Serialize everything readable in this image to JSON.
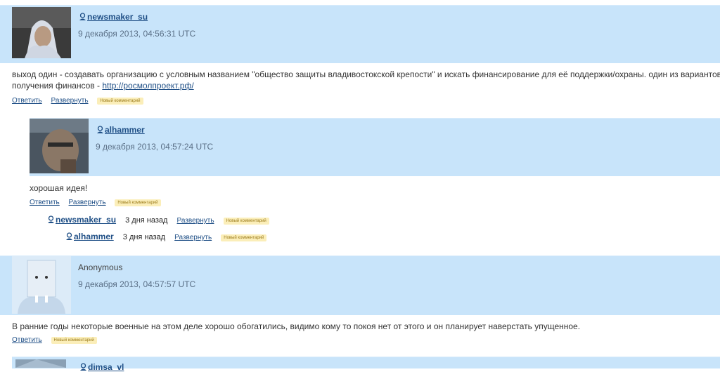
{
  "comments": [
    {
      "user": "newsmaker_su",
      "date": "9 декабря 2013, 04:56:31 UTC",
      "text_line1": "выход один - создавать организацию с условным названием \"общество защиты владивостокской крепости\" и искать финансирование для её поддержки/охраны. один из вариантов",
      "text_line2_prefix": "получения финансов - ",
      "link": "http://росмолпроект.рф/",
      "reply": "Ответить",
      "expand": "Развернуть",
      "badge": "Новый комментарий"
    },
    {
      "user": "alhammer",
      "date": "9 декабря 2013, 04:57:24 UTC",
      "text": "хорошая идея!",
      "reply": "Ответить",
      "expand": "Развернуть",
      "badge": "Новый комментарий"
    },
    {
      "user": "Anonymous",
      "date": "9 декабря 2013, 04:57:57 UTC",
      "text": "В ранние годы некоторые военные на этом деле хорошо обогатились, видимо кому то покоя нет от этого и он планирует наверстать упущенное.",
      "reply": "Ответить",
      "badge": "Новый комментарий"
    },
    {
      "user": "dimsa_vl"
    }
  ],
  "collapsed": [
    {
      "user": "newsmaker_su",
      "time": "3 дня назад",
      "expand": "Развернуть",
      "badge": "Новый комментарий"
    },
    {
      "user": "alhammer",
      "time": "3 дня назад",
      "expand": "Развернуть",
      "badge": "Новый комментарий"
    }
  ],
  "colors": {
    "band": "#c8e4fa",
    "link": "#1f4f86",
    "badge_bg": "#fbeeb9"
  },
  "icons": [
    "user-icon"
  ]
}
